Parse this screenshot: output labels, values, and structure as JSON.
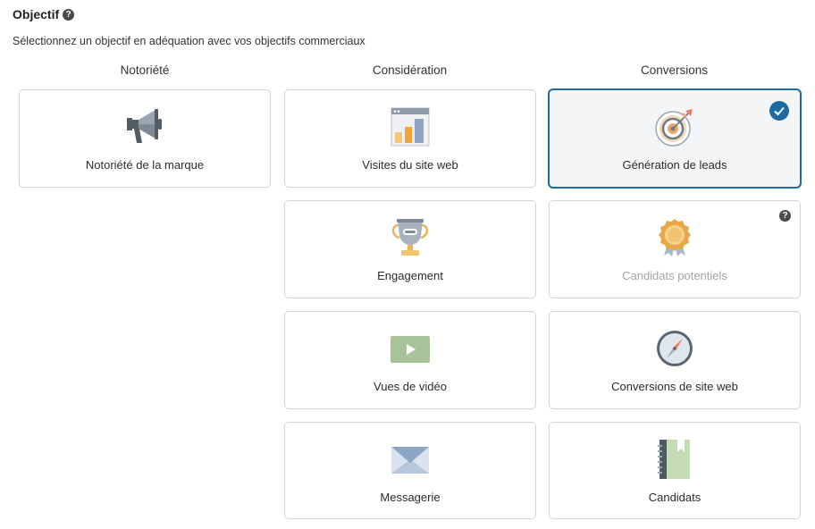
{
  "header": {
    "title": "Objectif",
    "help_icon": "question-circle-icon"
  },
  "subtitle": "Sélectionnez un objectif en adéquation avec vos objectifs commerciaux",
  "columns": [
    {
      "heading": "Notoriété"
    },
    {
      "heading": "Considération"
    },
    {
      "heading": "Conversions"
    }
  ],
  "cards": {
    "brand_awareness": {
      "label": "Notoriété de la marque",
      "icon": "megaphone-icon"
    },
    "website_visits": {
      "label": "Visites du site web",
      "icon": "bar-chart-window-icon"
    },
    "engagement": {
      "label": "Engagement",
      "icon": "trophy-icon"
    },
    "video_views": {
      "label": "Vues de vidéo",
      "icon": "video-play-icon"
    },
    "messaging": {
      "label": "Messagerie",
      "icon": "envelope-icon"
    },
    "lead_generation": {
      "label": "Génération de leads",
      "icon": "target-arrow-icon",
      "selected": true
    },
    "talent_leads": {
      "label": "Candidats potentiels",
      "icon": "award-ribbon-icon",
      "disabled": true,
      "help_icon": "question-circle-icon"
    },
    "website_conversions": {
      "label": "Conversions de site web",
      "icon": "compass-icon"
    },
    "job_applicants": {
      "label": "Candidats",
      "icon": "notebook-icon"
    }
  },
  "colors": {
    "accent": "#1d6aa5",
    "selected_bg": "#f3f5f7",
    "disabled_text": "#a3a3a3",
    "border": "#d4d4d4"
  }
}
